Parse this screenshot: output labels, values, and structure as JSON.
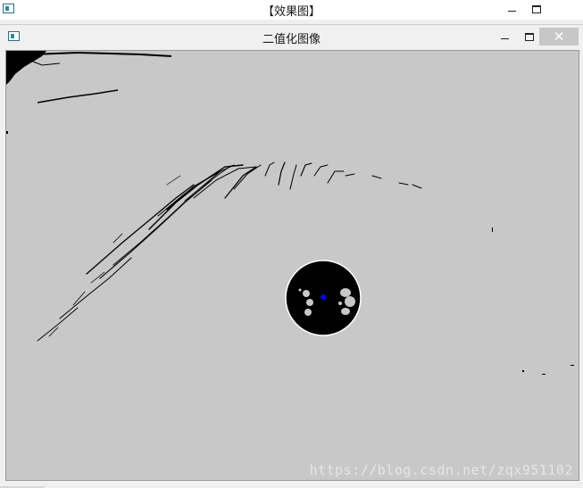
{
  "outer_window": {
    "title": "【效果图】",
    "controls": {
      "minimize": "minimize-icon",
      "maximize": "maximize-icon"
    }
  },
  "inner_window": {
    "title": "二值化图像",
    "controls": {
      "minimize": "minimize-icon",
      "maximize": "maximize-icon",
      "close_label": "✕"
    }
  },
  "image": {
    "background_color": "#c8c8c8",
    "foreground_color": "#000000",
    "center_marker_color": "#0000ff",
    "watermark": "https://blog.csdn.net/zqx951102"
  }
}
